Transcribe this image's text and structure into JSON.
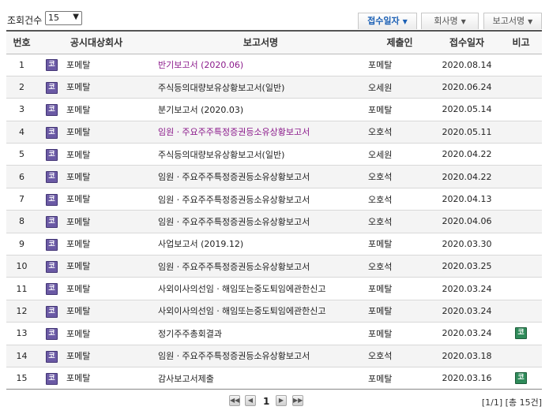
{
  "toolbar": {
    "count_label": "조회건수",
    "count_value": "15",
    "sort_buttons": [
      {
        "label": "접수일자"
      },
      {
        "label": "회사명"
      },
      {
        "label": "보고서명"
      }
    ]
  },
  "table": {
    "headers": [
      "번호",
      "공시대상회사",
      "보고서명",
      "제출인",
      "접수일자",
      "비고"
    ],
    "badge_label": "코",
    "rows": [
      {
        "no": "1",
        "company": "포메탈",
        "report": "반기보고서 (2020.06)",
        "submitter": "포메탈",
        "date": "2020.08.14",
        "modified": true,
        "note": ""
      },
      {
        "no": "2",
        "company": "포메탈",
        "report": "주식등의대량보유상황보고서(일반)",
        "submitter": "오세원",
        "date": "2020.06.24",
        "modified": false,
        "note": ""
      },
      {
        "no": "3",
        "company": "포메탈",
        "report": "분기보고서 (2020.03)",
        "submitter": "포메탈",
        "date": "2020.05.14",
        "modified": false,
        "note": ""
      },
      {
        "no": "4",
        "company": "포메탈",
        "report": "임원ㆍ주요주주특정증권등소유상황보고서",
        "submitter": "오호석",
        "date": "2020.05.11",
        "modified": true,
        "note": ""
      },
      {
        "no": "5",
        "company": "포메탈",
        "report": "주식등의대량보유상황보고서(일반)",
        "submitter": "오세원",
        "date": "2020.04.22",
        "modified": false,
        "note": ""
      },
      {
        "no": "6",
        "company": "포메탈",
        "report": "임원ㆍ주요주주특정증권등소유상황보고서",
        "submitter": "오호석",
        "date": "2020.04.22",
        "modified": false,
        "note": ""
      },
      {
        "no": "7",
        "company": "포메탈",
        "report": "임원ㆍ주요주주특정증권등소유상황보고서",
        "submitter": "오호석",
        "date": "2020.04.13",
        "modified": false,
        "note": ""
      },
      {
        "no": "8",
        "company": "포메탈",
        "report": "임원ㆍ주요주주특정증권등소유상황보고서",
        "submitter": "오호석",
        "date": "2020.04.06",
        "modified": false,
        "note": ""
      },
      {
        "no": "9",
        "company": "포메탈",
        "report": "사업보고서 (2019.12)",
        "submitter": "포메탈",
        "date": "2020.03.30",
        "modified": false,
        "note": ""
      },
      {
        "no": "10",
        "company": "포메탈",
        "report": "임원ㆍ주요주주특정증권등소유상황보고서",
        "submitter": "오호석",
        "date": "2020.03.25",
        "modified": false,
        "note": ""
      },
      {
        "no": "11",
        "company": "포메탈",
        "report": "사외이사의선임ㆍ해임또는중도퇴임에관한신고",
        "submitter": "포메탈",
        "date": "2020.03.24",
        "modified": false,
        "note": ""
      },
      {
        "no": "12",
        "company": "포메탈",
        "report": "사외이사의선임ㆍ해임또는중도퇴임에관한신고",
        "submitter": "포메탈",
        "date": "2020.03.24",
        "modified": false,
        "note": ""
      },
      {
        "no": "13",
        "company": "포메탈",
        "report": "정기주주총회결과",
        "submitter": "포메탈",
        "date": "2020.03.24",
        "modified": false,
        "note": "코"
      },
      {
        "no": "14",
        "company": "포메탈",
        "report": "임원ㆍ주요주주특정증권등소유상황보고서",
        "submitter": "오호석",
        "date": "2020.03.18",
        "modified": false,
        "note": ""
      },
      {
        "no": "15",
        "company": "포메탈",
        "report": "감사보고서제출",
        "submitter": "포메탈",
        "date": "2020.03.16",
        "modified": false,
        "note": "코"
      }
    ]
  },
  "pagination": {
    "current_page": "1",
    "info": "[1/1] [총 15건]"
  },
  "colors": {
    "modified_report": "#8b1a8b",
    "company_badge": "#6b5aa5",
    "note_badge": "#2f8b5a",
    "active_sort": "#1a5fb4"
  }
}
